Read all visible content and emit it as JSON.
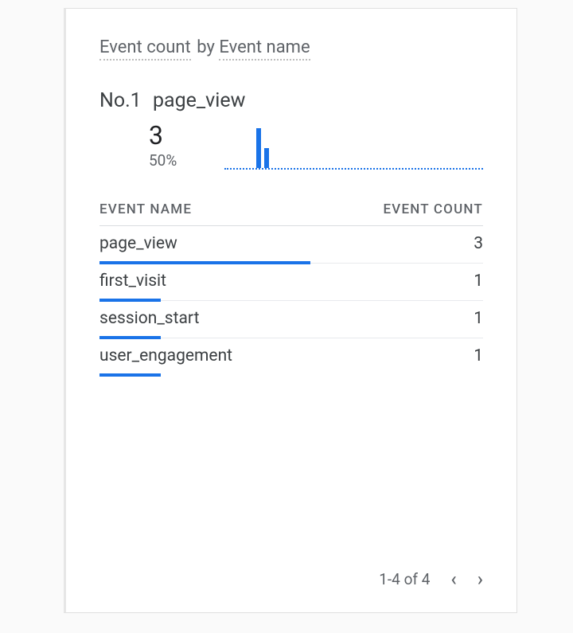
{
  "card": {
    "title_metric": "Event count",
    "title_by": "by",
    "title_dimension": "Event name"
  },
  "top": {
    "rank_prefix": "No.1",
    "name": "page_view",
    "value": "3",
    "percent": "50%"
  },
  "columns": {
    "name": "EVENT NAME",
    "count": "EVENT COUNT"
  },
  "rows": [
    {
      "name": "page_view",
      "count": "3",
      "bar_pct": 55
    },
    {
      "name": "first_visit",
      "count": "1",
      "bar_pct": 16
    },
    {
      "name": "session_start",
      "count": "1",
      "bar_pct": 16
    },
    {
      "name": "user_engagement",
      "count": "1",
      "bar_pct": 16
    }
  ],
  "pagination": {
    "label": "1-4 of 4"
  },
  "chart_data": {
    "type": "bar",
    "title": "Event count by Event name",
    "xlabel": "Event name",
    "ylabel": "Event count",
    "categories": [
      "page_view",
      "first_visit",
      "session_start",
      "user_engagement"
    ],
    "values": [
      3,
      1,
      1,
      1
    ],
    "ylim": [
      0,
      3
    ]
  }
}
